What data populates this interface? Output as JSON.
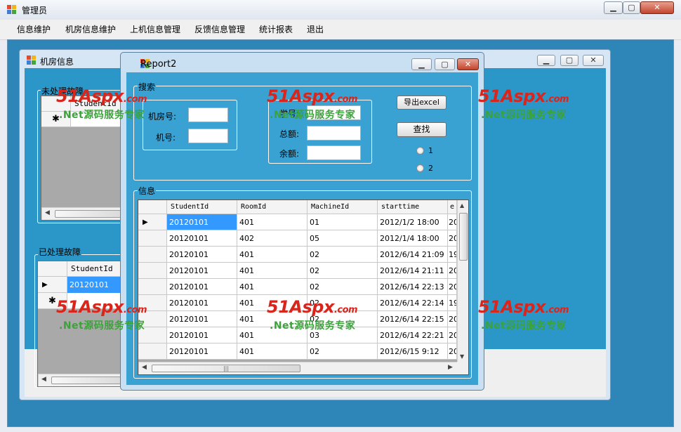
{
  "outer_window": {
    "title": "管理员"
  },
  "menu": [
    "信息维护",
    "机房信息维护",
    "上机信息管理",
    "反馈信息管理",
    "统计报表",
    "退出"
  ],
  "room_window": {
    "title": "机房信息",
    "unhandled_group": "未处理故障",
    "unhandled_header": "StudentId",
    "handled_group": "已处理故障",
    "handled_header": "StudentId",
    "handled_row": "20120101"
  },
  "report_window": {
    "title": "Report2",
    "search_group": "搜索",
    "room_no_label": "机房号:",
    "machine_no_label": "机号:",
    "student_no_label": "学号:",
    "total_label": "总额:",
    "balance_label": "余额:",
    "export_button": "导出excel",
    "search_button": "查找",
    "radio1": "1",
    "radio2": "2",
    "info_group": "信息",
    "columns": [
      "StudentId",
      "RoomId",
      "MachineId",
      "starttime",
      "e"
    ],
    "rows": [
      [
        "20120101",
        "401",
        "01",
        "2012/1/2 18:00",
        "20"
      ],
      [
        "20120101",
        "402",
        "05",
        "2012/1/4 18:00",
        "20"
      ],
      [
        "20120101",
        "401",
        "02",
        "2012/6/14 21:09",
        "19"
      ],
      [
        "20120101",
        "401",
        "02",
        "2012/6/14 21:11",
        "20"
      ],
      [
        "20120101",
        "401",
        "02",
        "2012/6/14 22:13",
        "20"
      ],
      [
        "20120101",
        "401",
        "02",
        "2012/6/14 22:14",
        "19"
      ],
      [
        "20120101",
        "401",
        "02",
        "2012/6/14 22:15",
        "20"
      ],
      [
        "20120101",
        "401",
        "03",
        "2012/6/14 22:21",
        "20"
      ],
      [
        "20120101",
        "401",
        "02",
        "2012/6/15 9:12",
        "20"
      ]
    ]
  },
  "watermark": {
    "logo": "51Aspx",
    "logo_suffix": ".com",
    "tagline": ".Net源码服务专家"
  },
  "colors": {
    "mdi_bg": "#2e86b8",
    "client_bg": "#3aa2d3",
    "selection": "#3399ff",
    "watermark_red": "#d9251c",
    "watermark_green": "#3ca23a"
  }
}
